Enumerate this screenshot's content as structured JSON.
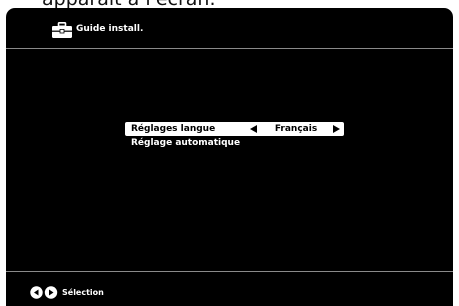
{
  "caption": "apparaît à l'écran.",
  "header": {
    "icon": "toolbox-icon",
    "title": "Guide install."
  },
  "menu": {
    "items": [
      {
        "label": "Réglages langue",
        "value": "Français",
        "selected": true
      },
      {
        "label": "Réglage automatique",
        "selected": false
      }
    ]
  },
  "footer": {
    "icons": [
      "left-button-icon",
      "right-button-icon"
    ],
    "label": "Sélection"
  },
  "colors": {
    "screen_background": "#000000",
    "text": "#ffffff",
    "highlight": "#ffffff",
    "highlight_text": "#000000",
    "divider": "#8a8a8a"
  }
}
